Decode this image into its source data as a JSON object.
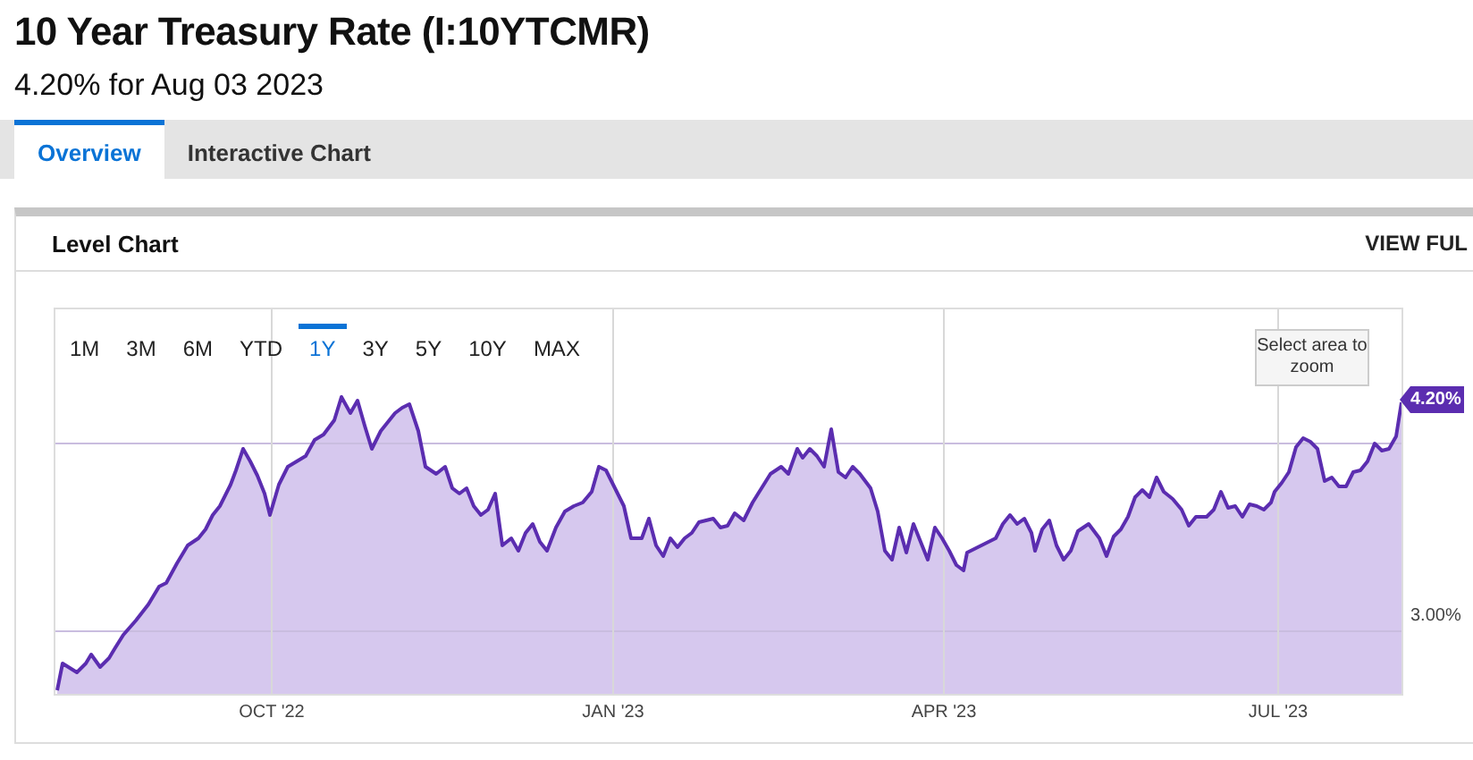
{
  "title": "10 Year Treasury Rate (I:10YTCMR)",
  "subtitle": "4.20% for Aug 03 2023",
  "tabs": [
    {
      "label": "Overview",
      "selected": true
    },
    {
      "label": "Interactive Chart",
      "selected": false
    }
  ],
  "card": {
    "title": "Level Chart",
    "action": "VIEW FUL",
    "ranges": [
      {
        "label": "1M",
        "selected": false
      },
      {
        "label": "3M",
        "selected": false
      },
      {
        "label": "6M",
        "selected": false
      },
      {
        "label": "YTD",
        "selected": false
      },
      {
        "label": "1Y",
        "selected": true
      },
      {
        "label": "3Y",
        "selected": false
      },
      {
        "label": "5Y",
        "selected": false
      },
      {
        "label": "10Y",
        "selected": false
      },
      {
        "label": "MAX",
        "selected": false
      }
    ],
    "zoom_hint": "Select area to zoom",
    "last_value": "4.20%",
    "y_label": "3.00%",
    "x_labels": [
      "OCT '22",
      "JAN '23",
      "APR '23",
      "JUL '23"
    ]
  }
}
